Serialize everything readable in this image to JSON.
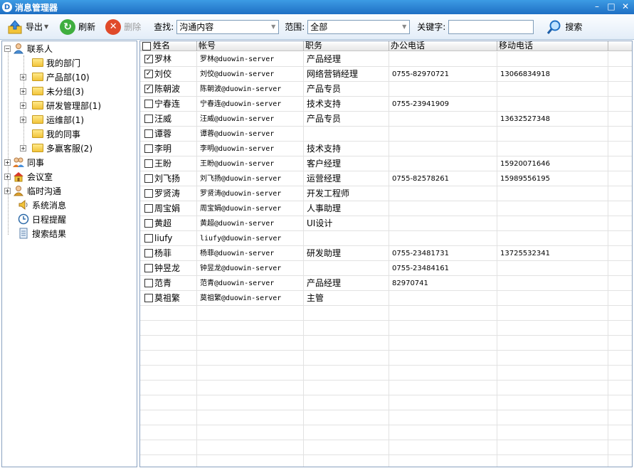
{
  "window": {
    "title": "消息管理器",
    "app_icon": "D"
  },
  "toolbar": {
    "export_label": "导出",
    "refresh_label": "刷新",
    "delete_label": "删除",
    "find_label": "查找:",
    "find_value": "沟通内容",
    "scope_label": "范围:",
    "scope_value": "全部",
    "keyword_label": "关键字:",
    "keyword_value": "",
    "search_label": "搜索"
  },
  "tree": {
    "contacts": "联系人",
    "my_dept": "我的部门",
    "product_dept": "产品部(10)",
    "ungrouped": "未分组(3)",
    "rd_mgmt": "研发管理部(1)",
    "ops_dept": "运维部(1)",
    "my_colleagues": "我的同事",
    "cs_dept": "多赢客服(2)",
    "colleagues": "同事",
    "meeting_room": "会议室",
    "temp_chat": "临时沟通",
    "sys_msg": "系统消息",
    "schedule": "日程提醒",
    "search_results": "搜索结果"
  },
  "grid": {
    "headers": {
      "name": "姓名",
      "account": "帐号",
      "title": "职务",
      "office": "办公电话",
      "mobile": "移动电话"
    },
    "rows": [
      {
        "checked": true,
        "name": "罗林",
        "account": "罗林@duowin-server",
        "title": "产品经理",
        "office": "",
        "mobile": ""
      },
      {
        "checked": true,
        "name": "刘佼",
        "account": "刘佼@duowin-server",
        "title": "网络营销经理",
        "office": "0755-82970721",
        "mobile": "13066834918"
      },
      {
        "checked": true,
        "name": "陈朝波",
        "account": "陈朝波@duowin-server",
        "title": "产品专员",
        "office": "",
        "mobile": ""
      },
      {
        "checked": false,
        "name": "宁春连",
        "account": "宁春连@duowin-server",
        "title": "技术支持",
        "office": "0755-23941909",
        "mobile": ""
      },
      {
        "checked": false,
        "name": "汪威",
        "account": "汪威@duowin-server",
        "title": "产品专员",
        "office": "",
        "mobile": "13632527348"
      },
      {
        "checked": false,
        "name": "谭蓉",
        "account": "谭蓉@duowin-server",
        "title": "",
        "office": "",
        "mobile": ""
      },
      {
        "checked": false,
        "name": "李明",
        "account": "李明@duowin-server",
        "title": "技术支持",
        "office": "",
        "mobile": ""
      },
      {
        "checked": false,
        "name": "王盼",
        "account": "王盼@duowin-server",
        "title": "客户经理",
        "office": "",
        "mobile": "15920071646"
      },
      {
        "checked": false,
        "name": "刘飞扬",
        "account": "刘飞扬@duowin-server",
        "title": "运营经理",
        "office": "0755-82578261",
        "mobile": "15989556195"
      },
      {
        "checked": false,
        "name": "罗贤涛",
        "account": "罗贤涛@duowin-server",
        "title": "开发工程师",
        "office": "",
        "mobile": ""
      },
      {
        "checked": false,
        "name": "周宝娟",
        "account": "周宝娟@duowin-server",
        "title": "人事助理",
        "office": "",
        "mobile": ""
      },
      {
        "checked": false,
        "name": "黄超",
        "account": "黄超@duowin-server",
        "title": "UI设计",
        "office": "",
        "mobile": ""
      },
      {
        "checked": false,
        "name": "liufy",
        "account": "liufy@duowin-server",
        "title": "",
        "office": "",
        "mobile": ""
      },
      {
        "checked": false,
        "name": "杨菲",
        "account": "杨菲@duowin-server",
        "title": "研发助理",
        "office": "0755-23481731",
        "mobile": "13725532341"
      },
      {
        "checked": false,
        "name": "钟昱龙",
        "account": "钟昱龙@duowin-server",
        "title": "",
        "office": "0755-23484161",
        "mobile": ""
      },
      {
        "checked": false,
        "name": "范青",
        "account": "范青@duowin-server",
        "title": "产品经理",
        "office": "82970741",
        "mobile": ""
      },
      {
        "checked": false,
        "name": "莫祖繁",
        "account": "莫祖繁@duowin-server",
        "title": "主管",
        "office": "",
        "mobile": ""
      }
    ]
  }
}
